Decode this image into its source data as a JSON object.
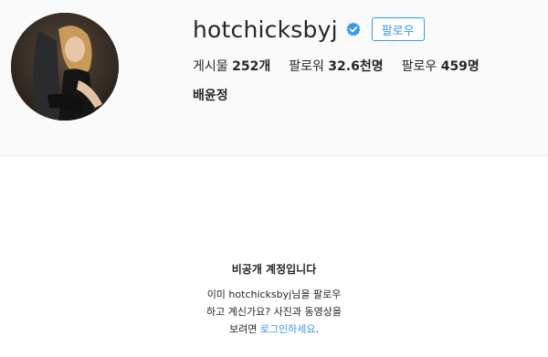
{
  "profile": {
    "username": "hotchicksbyj",
    "verified_icon": "verified-badge-icon",
    "follow_label": "팔로우",
    "full_name": "배윤정",
    "stats": {
      "posts_label": "게시물",
      "posts_value": "252개",
      "followers_label": "팔로워",
      "followers_value": "32.6천명",
      "following_label": "팔로우",
      "following_value": "459명"
    }
  },
  "private_notice": {
    "title": "비공개 계정입니다",
    "desc_prefix": "이미 hotchicksbyj님을 팔로우하고 계신가요? 사진과 동영상을 보려면 ",
    "login_link": "로그인하세요",
    "desc_suffix": "."
  },
  "colors": {
    "accent": "#3897f0",
    "verified": "#3897f0"
  }
}
